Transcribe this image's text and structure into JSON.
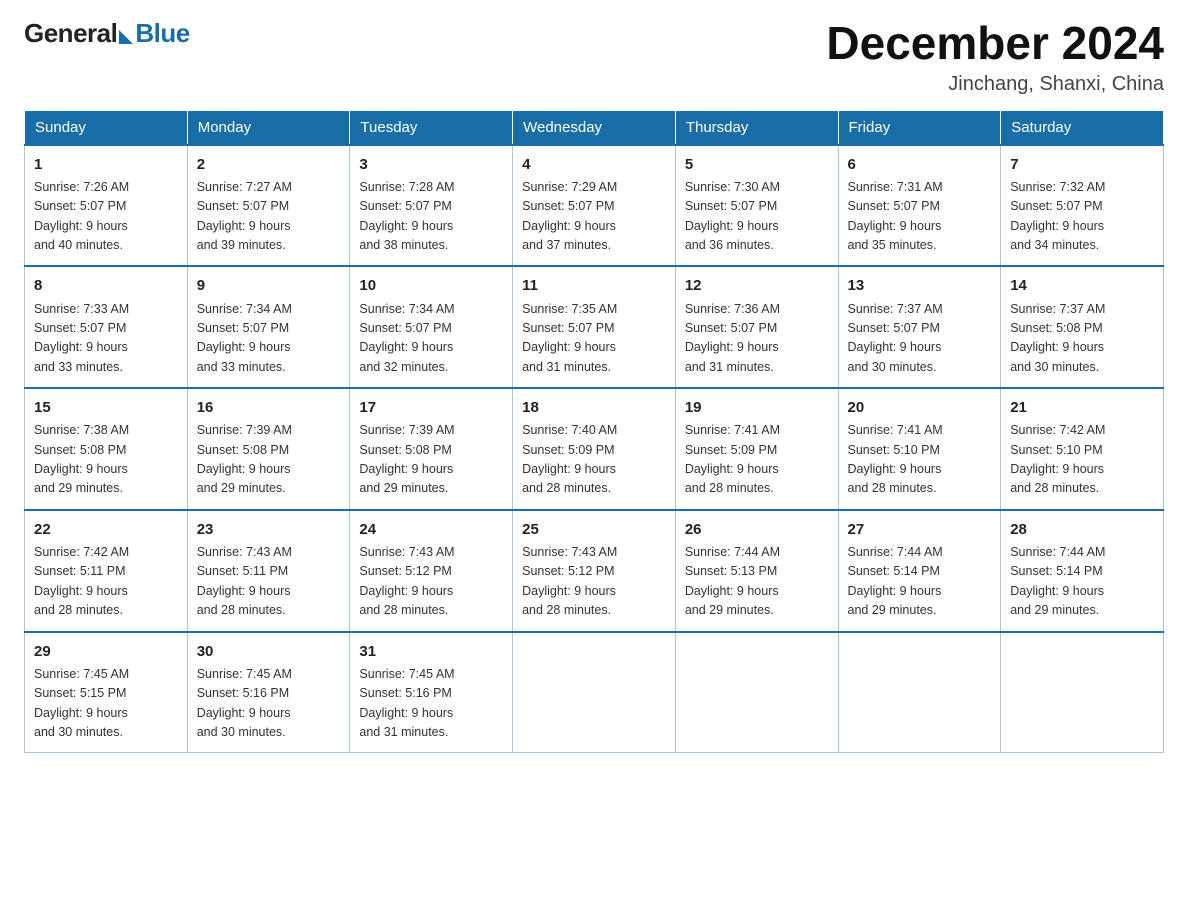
{
  "header": {
    "logo_general": "General",
    "logo_blue": "Blue",
    "title": "December 2024",
    "subtitle": "Jinchang, Shanxi, China"
  },
  "days_of_week": [
    "Sunday",
    "Monday",
    "Tuesday",
    "Wednesday",
    "Thursday",
    "Friday",
    "Saturday"
  ],
  "weeks": [
    [
      {
        "day": "1",
        "sunrise": "7:26 AM",
        "sunset": "5:07 PM",
        "daylight": "9 hours and 40 minutes."
      },
      {
        "day": "2",
        "sunrise": "7:27 AM",
        "sunset": "5:07 PM",
        "daylight": "9 hours and 39 minutes."
      },
      {
        "day": "3",
        "sunrise": "7:28 AM",
        "sunset": "5:07 PM",
        "daylight": "9 hours and 38 minutes."
      },
      {
        "day": "4",
        "sunrise": "7:29 AM",
        "sunset": "5:07 PM",
        "daylight": "9 hours and 37 minutes."
      },
      {
        "day": "5",
        "sunrise": "7:30 AM",
        "sunset": "5:07 PM",
        "daylight": "9 hours and 36 minutes."
      },
      {
        "day": "6",
        "sunrise": "7:31 AM",
        "sunset": "5:07 PM",
        "daylight": "9 hours and 35 minutes."
      },
      {
        "day": "7",
        "sunrise": "7:32 AM",
        "sunset": "5:07 PM",
        "daylight": "9 hours and 34 minutes."
      }
    ],
    [
      {
        "day": "8",
        "sunrise": "7:33 AM",
        "sunset": "5:07 PM",
        "daylight": "9 hours and 33 minutes."
      },
      {
        "day": "9",
        "sunrise": "7:34 AM",
        "sunset": "5:07 PM",
        "daylight": "9 hours and 33 minutes."
      },
      {
        "day": "10",
        "sunrise": "7:34 AM",
        "sunset": "5:07 PM",
        "daylight": "9 hours and 32 minutes."
      },
      {
        "day": "11",
        "sunrise": "7:35 AM",
        "sunset": "5:07 PM",
        "daylight": "9 hours and 31 minutes."
      },
      {
        "day": "12",
        "sunrise": "7:36 AM",
        "sunset": "5:07 PM",
        "daylight": "9 hours and 31 minutes."
      },
      {
        "day": "13",
        "sunrise": "7:37 AM",
        "sunset": "5:07 PM",
        "daylight": "9 hours and 30 minutes."
      },
      {
        "day": "14",
        "sunrise": "7:37 AM",
        "sunset": "5:08 PM",
        "daylight": "9 hours and 30 minutes."
      }
    ],
    [
      {
        "day": "15",
        "sunrise": "7:38 AM",
        "sunset": "5:08 PM",
        "daylight": "9 hours and 29 minutes."
      },
      {
        "day": "16",
        "sunrise": "7:39 AM",
        "sunset": "5:08 PM",
        "daylight": "9 hours and 29 minutes."
      },
      {
        "day": "17",
        "sunrise": "7:39 AM",
        "sunset": "5:08 PM",
        "daylight": "9 hours and 29 minutes."
      },
      {
        "day": "18",
        "sunrise": "7:40 AM",
        "sunset": "5:09 PM",
        "daylight": "9 hours and 28 minutes."
      },
      {
        "day": "19",
        "sunrise": "7:41 AM",
        "sunset": "5:09 PM",
        "daylight": "9 hours and 28 minutes."
      },
      {
        "day": "20",
        "sunrise": "7:41 AM",
        "sunset": "5:10 PM",
        "daylight": "9 hours and 28 minutes."
      },
      {
        "day": "21",
        "sunrise": "7:42 AM",
        "sunset": "5:10 PM",
        "daylight": "9 hours and 28 minutes."
      }
    ],
    [
      {
        "day": "22",
        "sunrise": "7:42 AM",
        "sunset": "5:11 PM",
        "daylight": "9 hours and 28 minutes."
      },
      {
        "day": "23",
        "sunrise": "7:43 AM",
        "sunset": "5:11 PM",
        "daylight": "9 hours and 28 minutes."
      },
      {
        "day": "24",
        "sunrise": "7:43 AM",
        "sunset": "5:12 PM",
        "daylight": "9 hours and 28 minutes."
      },
      {
        "day": "25",
        "sunrise": "7:43 AM",
        "sunset": "5:12 PM",
        "daylight": "9 hours and 28 minutes."
      },
      {
        "day": "26",
        "sunrise": "7:44 AM",
        "sunset": "5:13 PM",
        "daylight": "9 hours and 29 minutes."
      },
      {
        "day": "27",
        "sunrise": "7:44 AM",
        "sunset": "5:14 PM",
        "daylight": "9 hours and 29 minutes."
      },
      {
        "day": "28",
        "sunrise": "7:44 AM",
        "sunset": "5:14 PM",
        "daylight": "9 hours and 29 minutes."
      }
    ],
    [
      {
        "day": "29",
        "sunrise": "7:45 AM",
        "sunset": "5:15 PM",
        "daylight": "9 hours and 30 minutes."
      },
      {
        "day": "30",
        "sunrise": "7:45 AM",
        "sunset": "5:16 PM",
        "daylight": "9 hours and 30 minutes."
      },
      {
        "day": "31",
        "sunrise": "7:45 AM",
        "sunset": "5:16 PM",
        "daylight": "9 hours and 31 minutes."
      },
      null,
      null,
      null,
      null
    ]
  ]
}
